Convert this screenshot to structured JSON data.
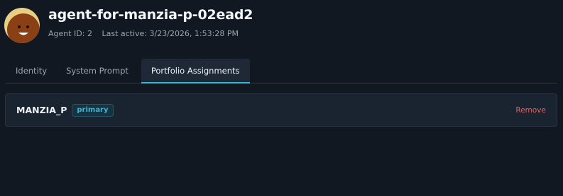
{
  "agent": {
    "name": "agent-for-manzia-p-02ead2",
    "id_text": "Agent ID: 2",
    "last_active_text": "Last active: 3/23/2026, 1:53:28 PM",
    "avatar_icon": "smiling-face-avatar"
  },
  "tabs": [
    {
      "label": "Identity",
      "active": false
    },
    {
      "label": "System Prompt",
      "active": false
    },
    {
      "label": "Portfolio Assignments",
      "active": true
    }
  ],
  "assignments": [
    {
      "portfolio": "MANZIA_P",
      "badge": "primary",
      "action_label": "Remove"
    }
  ],
  "colors": {
    "background": "#111822",
    "accent": "#38b6d6",
    "danger": "#e26262",
    "avatar_bg": "#e8cf86",
    "avatar_face": "#8b3f14"
  }
}
